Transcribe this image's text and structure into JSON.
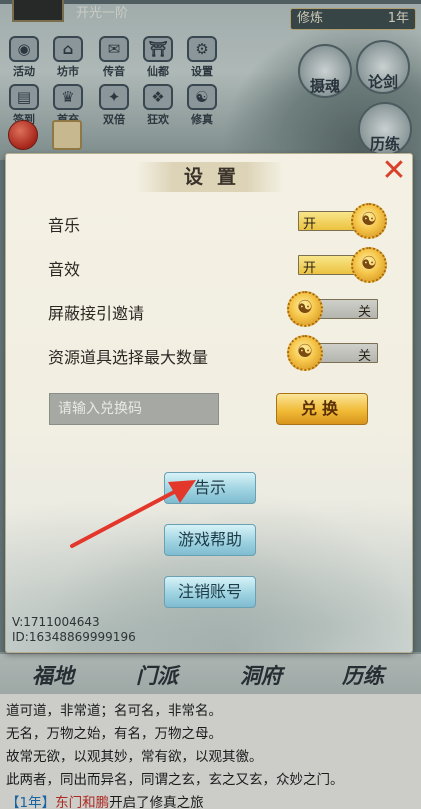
{
  "header": {
    "realm": "开光一阶",
    "cultivation_label": "修炼",
    "cultivation_value": "1年"
  },
  "menu": {
    "row1": [
      "活动",
      "坊市",
      "传音",
      "仙都",
      "设置"
    ],
    "row2": [
      "签到",
      "首充",
      "双倍",
      "狂欢",
      "修真"
    ],
    "right": [
      "摄魂",
      "论剑",
      "历练"
    ]
  },
  "dialog": {
    "title": "设置",
    "close_icon": "close-icon",
    "settings": [
      {
        "label": "音乐",
        "state": "开",
        "on": true
      },
      {
        "label": "音效",
        "state": "开",
        "on": true
      },
      {
        "label": "屏蔽接引邀请",
        "state": "关",
        "on": false
      },
      {
        "label": "资源道具选择最大数量",
        "state": "关",
        "on": false
      }
    ],
    "redeem_placeholder": "请输入兑换码",
    "redeem_button": "兑换",
    "notice_button": "告示",
    "help_button": "游戏帮助",
    "logout_button": "注销账号",
    "version": "V:1711004643",
    "user_id": "ID:16348869999196"
  },
  "bottom_tabs": [
    "福地",
    "门派",
    "洞府",
    "历练"
  ],
  "story": {
    "lines": [
      "道可道，非常道；名可名，非常名。",
      "无名，万物之始，有名，万物之母。",
      "故常无欲，以观其妙，常有欲，以观其徼。",
      "此两者，同出而异名，同谓之玄，玄之又玄，众妙之门。"
    ],
    "log_year": "【1年】",
    "log_highlight": "东门和鹏",
    "log_rest": "开启了修真之旅"
  },
  "colors": {
    "accent_red": "#d8412a",
    "toggle_on": "#ebc23f",
    "pill_blue": "#9fd3e1"
  }
}
